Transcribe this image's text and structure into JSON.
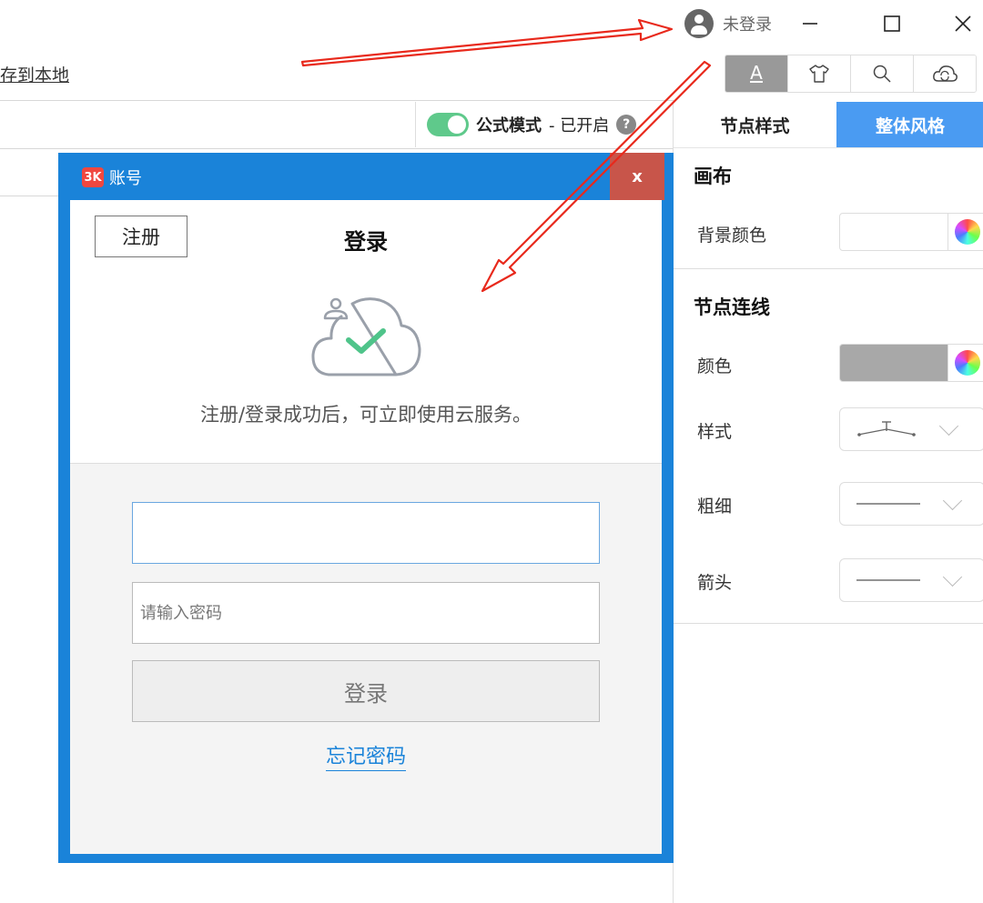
{
  "titlebar": {
    "login_status": "未登录",
    "min_icon": "minimize-icon",
    "max_icon": "maximize-icon",
    "close_icon": "close-icon"
  },
  "toolbar": {
    "save_local": "存到本地",
    "buttons": [
      {
        "icon": "text-style-icon",
        "glyph": "A",
        "active": true
      },
      {
        "icon": "tshirt-icon",
        "glyph": "👕",
        "active": false
      },
      {
        "icon": "search-icon",
        "glyph": "⌕",
        "active": false
      },
      {
        "icon": "cloud-sync-icon",
        "glyph": "☁",
        "active": false
      }
    ]
  },
  "formula": {
    "label": "公式模式",
    "status": "- 已开启",
    "help": "?"
  },
  "panel": {
    "tab_node_style": "节点样式",
    "tab_overall_style": "整体风格",
    "canvas_title": "画布",
    "bg_color_label": "背景颜色",
    "node_line_title": "节点连线",
    "color_label": "颜色",
    "style_label": "样式",
    "thickness_label": "粗细",
    "arrow_label": "箭头",
    "colors": {
      "bg_swatch": "#ffffff",
      "line_swatch": "#a8a8a8",
      "accent": "#4a9bf2"
    }
  },
  "dialog": {
    "title": "账号",
    "logo_text": "3K",
    "close_label": "x",
    "register_label": "注册",
    "login_title": "登录",
    "tip": "注册/登录成功后，可立即使用云服务。",
    "username_value": "",
    "password_placeholder": "请输入密码",
    "login_button": "登录",
    "forgot_password": "忘记密码",
    "colors": {
      "frame": "#1a83d9",
      "close_bg": "#c8554a",
      "check": "#4fc48a"
    }
  }
}
